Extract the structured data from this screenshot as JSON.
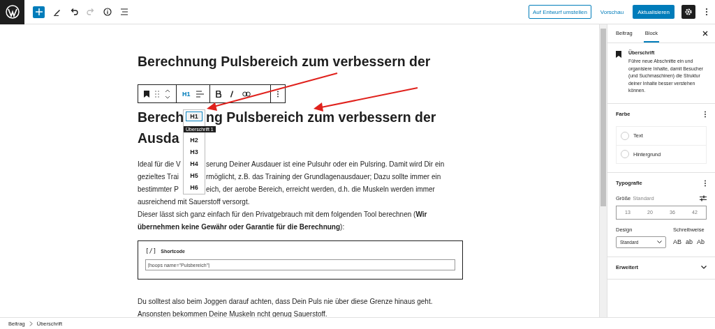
{
  "header": {
    "redo_disabled": true,
    "settings_pressed": true,
    "buttons": [
      {
        "label": "Auf Entwurf umstellen",
        "kind": "outline"
      },
      {
        "label": "Vorschau",
        "kind": "link"
      },
      {
        "label": "Aktualisieren",
        "kind": "primary"
      }
    ]
  },
  "editor": {
    "blocks": [
      {
        "kind": "heading",
        "lines": [
          [
            "Berechnung Pulsbereich zum verbessern der"
          ]
        ]
      },
      {
        "kind": "heading",
        "lines": [
          [
            "Berech",
            "ng Pulsbereich zum verbessern der"
          ],
          [
            "Ausda"
          ]
        ]
      },
      {
        "kind": "paragraph",
        "lines": [
          [
            "Ideal für die V",
            "serung Deiner Ausdauer ist eine Pulsuhr oder ein Pulsring. Damit wird Dir ein"
          ],
          [
            "gezieltes Trai",
            "rmöglicht, z.B. das Training der Grundlagenausdauer; Dazu sollte immer ein"
          ],
          [
            "bestimmter P",
            "eich, der aerobe Bereich, erreicht werden, d.h. die Muskeln werden immer"
          ],
          [
            "ausreichend mit Sauerstoff versorgt."
          ],
          [
            "Dieser lässt sich ganz einfach für den Privatgebrauch mit dem folgenden Tool berechnen (**Wir**"
          ],
          [
            "**übernehmen keine Gewähr oder Garantie für die Berechnung**):"
          ]
        ]
      },
      {
        "kind": "shortcode",
        "label": "Shortcode",
        "icon": "[/]",
        "value": "[hoops name=\"Pulsbereich\"]"
      },
      {
        "kind": "paragraph",
        "lines": [
          [
            "Du solltest also beim Joggen darauf achten, dass Dein Puls nie über diese Grenze hinaus geht."
          ],
          [
            "Ansonsten bekommen Deine Muskeln ncht genug Sauerstoff."
          ]
        ]
      }
    ],
    "block_toolbar": {
      "level": "H1"
    },
    "level_menu": [
      {
        "label": "H1",
        "selected": true
      },
      {
        "label": "H2",
        "selected": false
      },
      {
        "label": "H3",
        "selected": false
      },
      {
        "label": "H4",
        "selected": false
      },
      {
        "label": "H5",
        "selected": false
      },
      {
        "label": "H6",
        "selected": false
      }
    ],
    "tooltip": "Überschrift 1"
  },
  "sidebar": {
    "tabs": [
      {
        "label": "Beitrag",
        "selected": false
      },
      {
        "label": "Block",
        "selected": true
      }
    ],
    "block": {
      "title": "Überschrift",
      "description": "Führe neue Abschnitte ein und organisiere Inhalte, damit Besucher (und Suchmaschinen) die Struktur deiner Inhalte besser verstehen können."
    },
    "color": {
      "title": "Farbe",
      "items": [
        "Text",
        "Hintergrund"
      ]
    },
    "typography": {
      "title": "Typografie",
      "size_label": "Größe",
      "size_value": "Standard",
      "sizes": [
        "13",
        "20",
        "36",
        "42"
      ],
      "design_label": "Design",
      "design_value": "Standard",
      "case_label": "Schreibweise",
      "cases": [
        "AB",
        "ab",
        "Ab"
      ]
    },
    "advanced": {
      "title": "Erweitert",
      "expanded": false
    }
  },
  "breadcrumb": [
    "Beitrag",
    "Überschrift"
  ]
}
